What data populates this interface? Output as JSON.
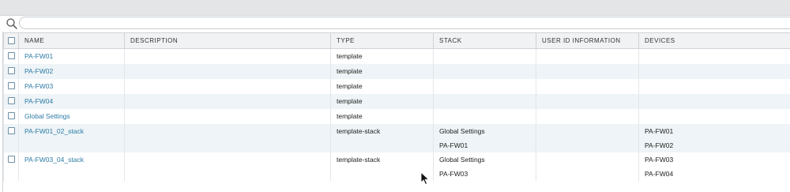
{
  "search": {
    "placeholder": "",
    "value": ""
  },
  "columns": [
    "NAME",
    "DESCRIPTION",
    "TYPE",
    "STACK",
    "USER ID INFORMATION",
    "DEVICES"
  ],
  "rows": [
    {
      "name": "PA-FW01",
      "description": "",
      "type": "template",
      "stack": [],
      "user_id": "",
      "devices": []
    },
    {
      "name": "PA-FW02",
      "description": "",
      "type": "template",
      "stack": [],
      "user_id": "",
      "devices": []
    },
    {
      "name": "PA-FW03",
      "description": "",
      "type": "template",
      "stack": [],
      "user_id": "",
      "devices": []
    },
    {
      "name": "PA-FW04",
      "description": "",
      "type": "template",
      "stack": [],
      "user_id": "",
      "devices": []
    },
    {
      "name": "Global Settings",
      "description": "",
      "type": "template",
      "stack": [],
      "user_id": "",
      "devices": []
    },
    {
      "name": "PA-FW01_02_stack",
      "description": "",
      "type": "template-stack",
      "stack": [
        "Global Settings",
        "PA-FW01"
      ],
      "user_id": "",
      "devices": [
        "PA-FW01",
        "PA-FW02"
      ]
    },
    {
      "name": "PA-FW03_04_stack",
      "description": "",
      "type": "template-stack",
      "stack": [
        "Global Settings",
        "PA-FW03"
      ],
      "user_id": "",
      "devices": [
        "PA-FW03",
        "PA-FW04"
      ]
    }
  ],
  "colors": {
    "link": "#2c7ba5",
    "header_bg": "#f1f2f4",
    "alt_row_bg": "#eef4f7",
    "topbar_bg": "#e3e5e7"
  },
  "icons": {
    "search": "magnifier",
    "cursor": "arrow-pointer"
  }
}
